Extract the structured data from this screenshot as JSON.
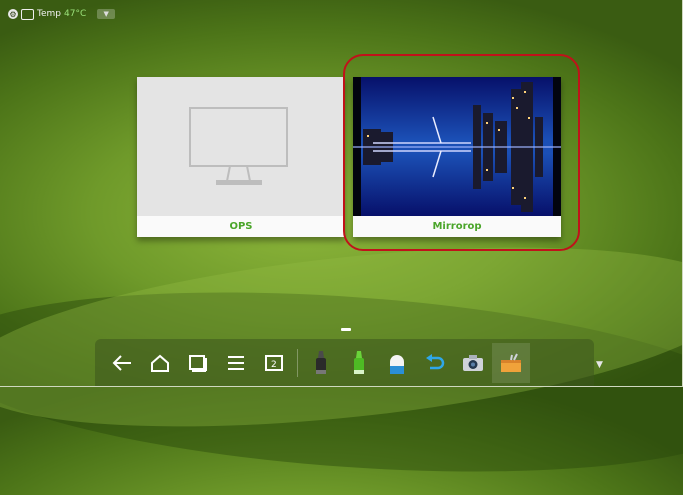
{
  "status_bar": {
    "temp_label": "Temp",
    "temp_value": "47°C"
  },
  "sources": [
    {
      "label": "OPS",
      "icon": "monitor-icon"
    },
    {
      "label": "Mirrorop",
      "icon": "city-preview-image"
    }
  ],
  "taskbar": {
    "items": [
      {
        "name": "back-icon"
      },
      {
        "name": "home-icon"
      },
      {
        "name": "recent-apps-icon"
      },
      {
        "name": "menu-icon"
      },
      {
        "name": "whiteboard-icon"
      },
      {
        "name": "black-marker-icon"
      },
      {
        "name": "green-highlighter-icon"
      },
      {
        "name": "eraser-icon"
      },
      {
        "name": "undo-icon"
      },
      {
        "name": "camera-icon"
      },
      {
        "name": "toolbox-icon"
      }
    ]
  },
  "colors": {
    "caption_text": "#4aa52a",
    "highlight_ring": "#c0121a",
    "temp_text": "#9be27a"
  }
}
